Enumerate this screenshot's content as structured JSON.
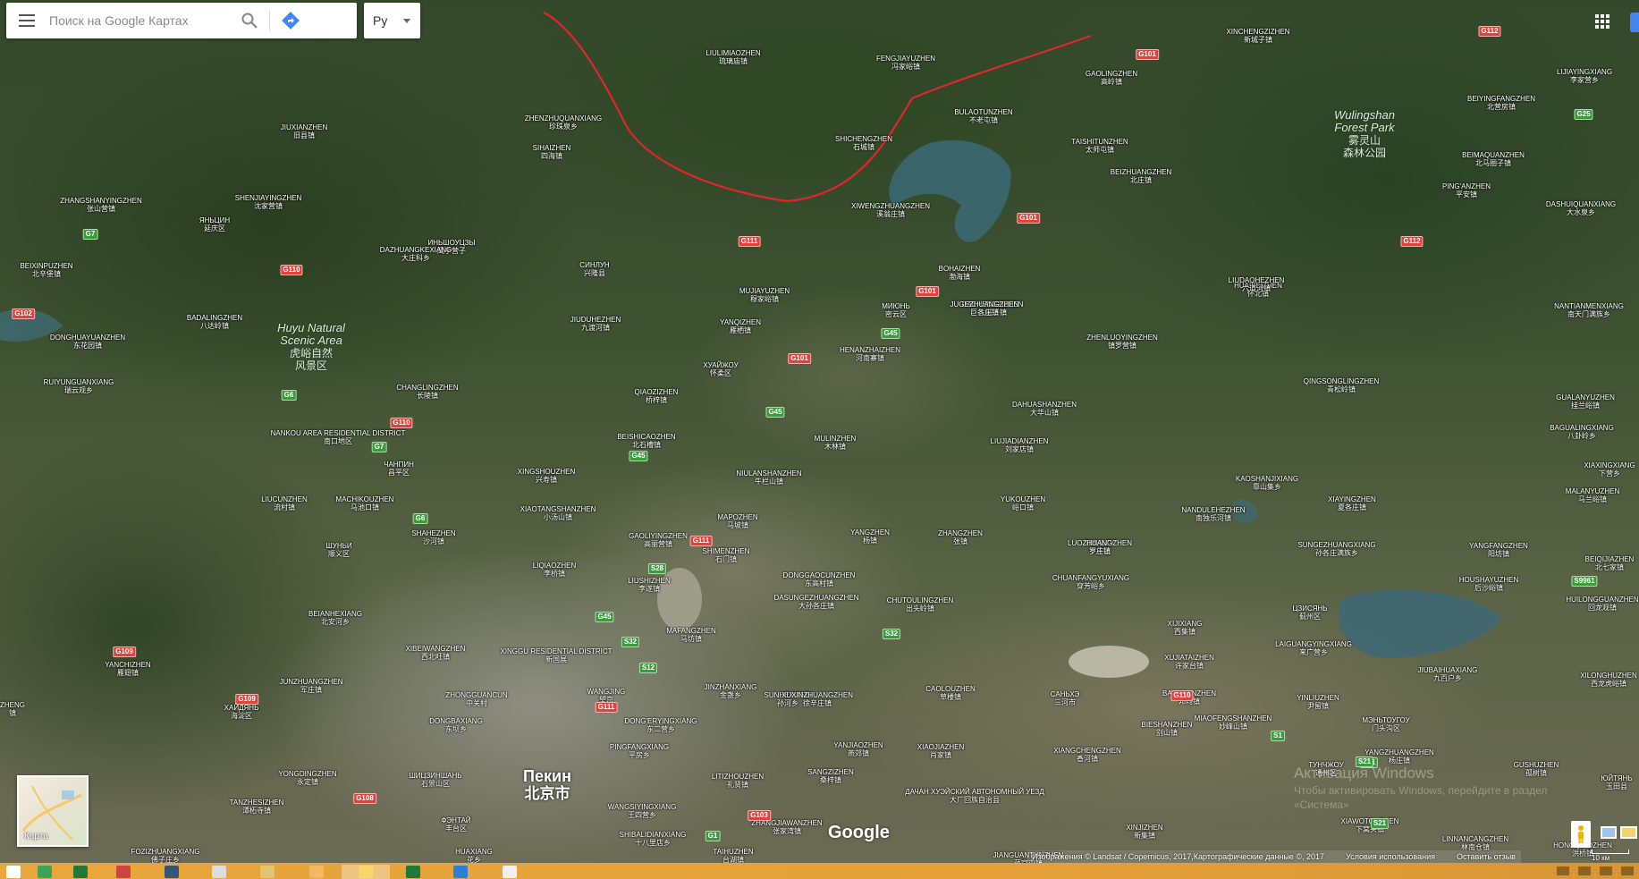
{
  "search": {
    "placeholder": "Поиск на Google Картах"
  },
  "language": {
    "label": "Ру"
  },
  "minimap": {
    "label": "Карта"
  },
  "logo": {
    "text": "Google"
  },
  "attribution": {
    "imagery": "Изображения © Landsat / Copernicus, 2017,Картографические данные ©, 2017",
    "terms": "Условия использования",
    "feedback": "Оставить отзыв"
  },
  "scale": {
    "label": "10 км"
  },
  "watermark": {
    "title": "Активация Windows",
    "subtitle": "Чтобы активировать Windows, перейдите в раздел",
    "subtitle2": "«Система»"
  },
  "colors": {
    "route": "#e0262a",
    "taskbar": "#e6a13a",
    "shield_red": "#e0433c",
    "shield_green": "#3c9c3b"
  },
  "city": {
    "ru": "Пекин",
    "zh": "北京市"
  },
  "parks": [
    {
      "en": "Huyu Natural Scenic Area",
      "en1": "Huyu Natural",
      "en2": "Scenic Area",
      "zh1": "虎峪自然",
      "zh2": "风景区"
    },
    {
      "en1": "Wulingshan",
      "en2": "Forest Park",
      "zh1": "雾灵山",
      "zh2": "森林公园"
    }
  ],
  "places": [
    {
      "en": "JIUXIANZHEN",
      "zh": "旧县镇"
    },
    {
      "en": "ZHENZHUQUANXIANG",
      "zh": "珍珠泉乡"
    },
    {
      "en": "LIULIMIAOZHEN",
      "zh": "琉璃庙镇"
    },
    {
      "en": "FENGJIAYUZHEN",
      "zh": "冯家峪镇"
    },
    {
      "en": "XINCHENGZIZHEN",
      "zh": "新城子镇"
    },
    {
      "en": "GAOLINGZHEN",
      "zh": "高岭镇"
    },
    {
      "en": "LIJIAYINGXIANG",
      "zh": "李家营乡"
    },
    {
      "en": "BEIYINGFANGZHEN",
      "zh": "北营房镇"
    },
    {
      "en": "SHICHENGZHEN",
      "zh": "石城镇"
    },
    {
      "en": "BULAOTUNZHEN",
      "zh": "不老屯镇"
    },
    {
      "en": "TAISHITUNZHEN",
      "zh": "太师屯镇"
    },
    {
      "en": "SIHAIZHEN",
      "zh": "四海镇"
    },
    {
      "en": "ZHANGSHANYINGZHEN",
      "zh": "张山营镇"
    },
    {
      "en": "SHENJIAYINGZHEN",
      "zh": "沈家营镇"
    },
    {
      "en": "ЯНЬЦИН",
      "zh": "延庆区"
    },
    {
      "en": "ИНЬШОУЦЗЫ",
      "zh": "鹰手营子"
    },
    {
      "en": "BEIMAQUANZHEN",
      "zh": "北马圈子镇"
    },
    {
      "en": "BEIZHUANGZHEN",
      "zh": "北庄镇"
    },
    {
      "en": "XIWENGZHUANGZHEN",
      "zh": "溪翁庄镇"
    },
    {
      "en": "PING'ANZHEN",
      "zh": "平安镇"
    },
    {
      "en": "DAZHUANGKEXIANG",
      "zh": "大庄科乡"
    },
    {
      "en": "BEIXINPUZHEN",
      "zh": "北辛堡镇"
    },
    {
      "en": "DASHUIQUANXIANG",
      "zh": "大水泉乡"
    },
    {
      "en": "СИНЛУН",
      "zh": "兴隆县"
    },
    {
      "en": "BOHAIZHEN",
      "zh": "渤海镇"
    },
    {
      "en": "MUJIAYUZHEN",
      "zh": "穆家峪镇"
    },
    {
      "en": "HUAIBEIZHEN",
      "zh": "怀北镇"
    },
    {
      "en": "DACHENGZIZHEN",
      "zh": "大城子镇"
    },
    {
      "en": "LIUDAOHEZHEN",
      "zh": "六道河镇"
    },
    {
      "en": "JUGEZHUANGZHEN",
      "zh": "巨各庄镇"
    },
    {
      "en": "МИЮНЬ",
      "zh": "密云区"
    },
    {
      "en": "NANTIANMENXIANG",
      "zh": "南天门满族乡"
    },
    {
      "en": "BADALINGZHEN",
      "zh": "八达岭镇"
    },
    {
      "en": "DONGHUAYUANZHEN",
      "zh": "东花园镇"
    },
    {
      "en": "JIUDUHEZHEN",
      "zh": "九渡河镇"
    },
    {
      "en": "YANQIZHEN",
      "zh": "雁栖镇"
    },
    {
      "en": "HENANZHAIZHEN",
      "zh": "河南寨镇"
    },
    {
      "en": "ZHENLUOYINGZHEN",
      "zh": "镇罗营镇"
    },
    {
      "en": "RUIYUNGUANXIANG",
      "zh": "瑞云观乡"
    },
    {
      "en": "ХУАЙЖОУ",
      "zh": "怀柔区"
    },
    {
      "en": "CHANGLINGZHEN",
      "zh": "长陵镇"
    },
    {
      "en": "QIAOZIZHEN",
      "zh": "桥梓镇"
    },
    {
      "en": "QINGSONGLINGZHEN",
      "zh": "青松岭镇"
    },
    {
      "en": "DAHUASHANZHEN",
      "zh": "大华山镇"
    },
    {
      "en": "GUALANYUZHEN",
      "zh": "挂兰峪镇"
    },
    {
      "en": "NANKOU AREA RESIDENTIAL DISTRICT",
      "zh": "南口地区"
    },
    {
      "en": "BAGUALINGXIANG",
      "zh": "八卦岭乡"
    },
    {
      "en": "BEISHICAOZHEN",
      "zh": "北石槽镇"
    },
    {
      "en": "MULINZHEN",
      "zh": "木林镇"
    },
    {
      "en": "LIUJIADIANZHEN",
      "zh": "刘家店镇"
    },
    {
      "en": "XIAXINGXIANG",
      "zh": "下营乡"
    },
    {
      "en": "ЧАНПИН",
      "zh": "昌平区"
    },
    {
      "en": "XINGSHOUZHEN",
      "zh": "兴寿镇"
    },
    {
      "en": "NIULANSHANZHEN",
      "zh": "牛栏山镇"
    },
    {
      "en": "KAOSHANJIXIANG",
      "zh": "靠山集乡"
    },
    {
      "en": "MALANYUZHEN",
      "zh": "马兰峪镇"
    },
    {
      "en": "LIUCUNZHEN",
      "zh": "流村镇"
    },
    {
      "en": "MACHIKOUZHEN",
      "zh": "马池口镇"
    },
    {
      "en": "YUKOUZHEN",
      "zh": "峪口镇"
    },
    {
      "en": "XIAYINGZHEN",
      "zh": "夏各庄镇"
    },
    {
      "en": "XIAOTANGSHANZHEN",
      "zh": "小汤山镇"
    },
    {
      "en": "MAPOZHEN",
      "zh": "马坡镇"
    },
    {
      "en": "NANDULEHEZHEN",
      "zh": "南独乐河镇"
    },
    {
      "en": "SHAHEZHEN",
      "zh": "沙河镇"
    },
    {
      "en": "GAOLIYINGZHEN",
      "zh": "高丽营镇"
    },
    {
      "en": "YANGZHEN",
      "zh": "杨镇"
    },
    {
      "en": "ZHANGZHEN",
      "zh": "张镇"
    },
    {
      "en": "ПИНЬГУ",
      "zh": "平谷区"
    },
    {
      "en": "LUOZHUANGZHEN",
      "zh": "罗庄镇"
    },
    {
      "en": "SUNGEZHUANGXIANG",
      "zh": "孙各庄满族乡"
    },
    {
      "en": "YANGFANGZHEN",
      "zh": "阳坊镇"
    },
    {
      "en": "ШУНЬИ",
      "zh": "顺义区"
    },
    {
      "en": "SHIMENZHEN",
      "zh": "石门镇"
    },
    {
      "en": "BEIQIJIAZHEN",
      "zh": "北七家镇"
    },
    {
      "en": "LIQIAOZHEN",
      "zh": "李桥镇"
    },
    {
      "en": "DONGGAOCUNZHEN",
      "zh": "东高村镇"
    },
    {
      "en": "CHUANFANGYUXIANG",
      "zh": "穿芳峪乡"
    },
    {
      "en": "HOUSHAYUZHEN",
      "zh": "后沙峪镇"
    },
    {
      "en": "LIUSHIZHEN",
      "zh": "李遂镇"
    },
    {
      "en": "DASUNGEZHUANGZHEN",
      "zh": "大孙各庄镇"
    },
    {
      "en": "CHUTOULINGZHEN",
      "zh": "出头岭镇"
    },
    {
      "en": "HUILONGGUANZHEN",
      "zh": "回龙观镇"
    },
    {
      "en": "BEIANHEXIANG",
      "zh": "北安河乡"
    },
    {
      "en": "XIJIXIANG",
      "zh": "西集镇"
    },
    {
      "en": "ЦЗИСЯНЬ",
      "zh": "蓟州区"
    },
    {
      "en": "XIBEIWANGZHEN",
      "zh": "西北旺镇"
    },
    {
      "en": "LAIGUANGYINGXIANG",
      "zh": "来广营乡"
    },
    {
      "en": "XINGGU RESIDENTIAL DISTRICT",
      "zh": "新国展"
    },
    {
      "en": "MAFANGZHEN",
      "zh": "马坊镇"
    },
    {
      "en": "XUJIATAIZHEN",
      "zh": "许家台镇"
    },
    {
      "en": "JIUBAIHUAXIANG",
      "zh": "九百户乡"
    },
    {
      "en": "YANCHIZHEN",
      "zh": "雁翅镇"
    },
    {
      "en": "XILONGHUZHEN",
      "zh": "西龙虎峪镇"
    },
    {
      "en": "JUNZHUANGZHEN",
      "zh": "军庄镇"
    },
    {
      "en": "SUNHEXIANG",
      "zh": "孙河乡"
    },
    {
      "en": "CAOLOUZHEN",
      "zh": "草楼镇"
    },
    {
      "en": "САНЬХЭ",
      "zh": "三河市"
    },
    {
      "en": "BANGJUNZHEN",
      "zh": "邦均镇"
    },
    {
      "en": "YINLIUZHEN",
      "zh": "尹留镇"
    },
    {
      "en": "ZHONGGUANCUN",
      "zh": "中关村"
    },
    {
      "en": "WANGJING",
      "zh": "望京"
    },
    {
      "en": "JINZHANXIANG",
      "zh": "金盏乡"
    },
    {
      "en": "XUXINZHUANGZHEN",
      "zh": "徐辛庄镇"
    },
    {
      "en": "MIAOFENGSHANZHEN",
      "zh": "妙峰山镇"
    },
    {
      "en": "ХАЙДЯНЬ",
      "zh": "海淀区"
    },
    {
      "en": "DONGBAXIANG",
      "zh": "东坝乡"
    },
    {
      "en": "DONG'ERYINGXIANG",
      "zh": "东二营乡"
    },
    {
      "en": "BIESHANZHEN",
      "zh": "别山镇"
    },
    {
      "en": "МЭНЬТОУГОУ",
      "zh": "门头沟区"
    },
    {
      "en": "YANJIAOZHEN",
      "zh": "燕郊镇"
    },
    {
      "en": "XIAOJIAZHEN",
      "zh": "肖家镇"
    },
    {
      "en": "XIANGCHENGZHEN",
      "zh": "香河镇"
    },
    {
      "en": "YANGZHUANGZHEN",
      "zh": "杨庄镇"
    },
    {
      "en": "PINGFANGXIANG",
      "zh": "平房乡"
    },
    {
      "en": "YONGDINGZHEN",
      "zh": "永定镇"
    },
    {
      "en": "ШИЦЗИНШАНЬ",
      "zh": "石景山区"
    },
    {
      "en": "LITIZHOUZHEN",
      "zh": "礼贤镇"
    },
    {
      "en": "GUSHUZHEN",
      "zh": "孤树镇"
    },
    {
      "en": "ТУНЧЖОУ",
      "zh": "通州区"
    },
    {
      "en": "SANGZIZHEN",
      "zh": "桑梓镇"
    },
    {
      "en": "ДАЧАН ХУЭЙСКИЙ АВТОНОМНЫЙ УЕЗД",
      "zh": "大厂回族自治县"
    },
    {
      "en": "ЮЙТЯНЬ",
      "zh": "玉田县"
    },
    {
      "en": "TANZHESIZHEN",
      "zh": "潭柘寺镇"
    },
    {
      "en": "ФЭНТАЙ",
      "zh": "丰台区"
    },
    {
      "en": "WANGSIYINGXIANG",
      "zh": "王四营乡"
    },
    {
      "en": "ZHANGJIAWANZHEN",
      "zh": "张家湾镇"
    },
    {
      "en": "XIAWOTOUZHEN",
      "zh": "下窝头镇"
    },
    {
      "en": "XINJIZHEN",
      "zh": "新集镇"
    },
    {
      "en": "LINNANCANGZHEN",
      "zh": "林南仓镇"
    },
    {
      "en": "SHIBALIDIANXIANG",
      "zh": "十八里店乡"
    },
    {
      "en": "FOZIZHUANGXIANG",
      "zh": "佛子庄乡"
    },
    {
      "en": "HUAXIANG",
      "zh": "花乡"
    },
    {
      "en": "TAIHUZHEN",
      "zh": "台湖镇"
    },
    {
      "en": "JIANGUANTUNZHEN",
      "zh": "蒋官屯镇"
    },
    {
      "en": "HONGQIAOZHEN",
      "zh": "洪桥镇"
    },
    {
      "en": "ZHENG",
      "zh": "镇"
    }
  ],
  "shields": [
    {
      "label": "G101",
      "type": "red"
    },
    {
      "label": "G112",
      "type": "red"
    },
    {
      "label": "G25",
      "type": "green"
    },
    {
      "label": "G111",
      "type": "red"
    },
    {
      "label": "G101",
      "type": "red"
    },
    {
      "label": "G112",
      "type": "red"
    },
    {
      "label": "G110",
      "type": "red"
    },
    {
      "label": "G7",
      "type": "green"
    },
    {
      "label": "G101",
      "type": "red"
    },
    {
      "label": "G45",
      "type": "green"
    },
    {
      "label": "G101",
      "type": "red"
    },
    {
      "label": "G45",
      "type": "green"
    },
    {
      "label": "G6",
      "type": "green"
    },
    {
      "label": "G110",
      "type": "red"
    },
    {
      "label": "G7",
      "type": "green"
    },
    {
      "label": "G45",
      "type": "green"
    },
    {
      "label": "G6",
      "type": "green"
    },
    {
      "label": "G111",
      "type": "red"
    },
    {
      "label": "S28",
      "type": "green"
    },
    {
      "label": "G45",
      "type": "green"
    },
    {
      "label": "S32",
      "type": "green"
    },
    {
      "label": "S32",
      "type": "green"
    },
    {
      "label": "S12",
      "type": "green"
    },
    {
      "label": "G109",
      "type": "red"
    },
    {
      "label": "G109",
      "type": "red"
    },
    {
      "label": "G111",
      "type": "red"
    },
    {
      "label": "G108",
      "type": "red"
    },
    {
      "label": "G103",
      "type": "red"
    },
    {
      "label": "G1",
      "type": "green"
    },
    {
      "label": "S21",
      "type": "green"
    },
    {
      "label": "S21",
      "type": "green"
    },
    {
      "label": "S1",
      "type": "green"
    },
    {
      "label": "S21",
      "type": "green"
    },
    {
      "label": "G102",
      "type": "red"
    },
    {
      "label": "S9961",
      "type": "green"
    },
    {
      "label": "G110",
      "type": "red"
    }
  ],
  "taskbar": {
    "items": [
      {
        "icon": "windows-start-icon"
      },
      {
        "icon": "chrome-icon"
      },
      {
        "icon": "excel-icon"
      },
      {
        "icon": "tool-icon"
      },
      {
        "icon": "floppy-icon"
      },
      {
        "icon": "document-icon"
      },
      {
        "icon": "folder-icon"
      },
      {
        "icon": "paint-icon"
      },
      {
        "icon": "explorer-icon"
      },
      {
        "icon": "excel-app-icon"
      },
      {
        "icon": "browser-icon"
      },
      {
        "icon": "notepad-icon"
      }
    ]
  }
}
